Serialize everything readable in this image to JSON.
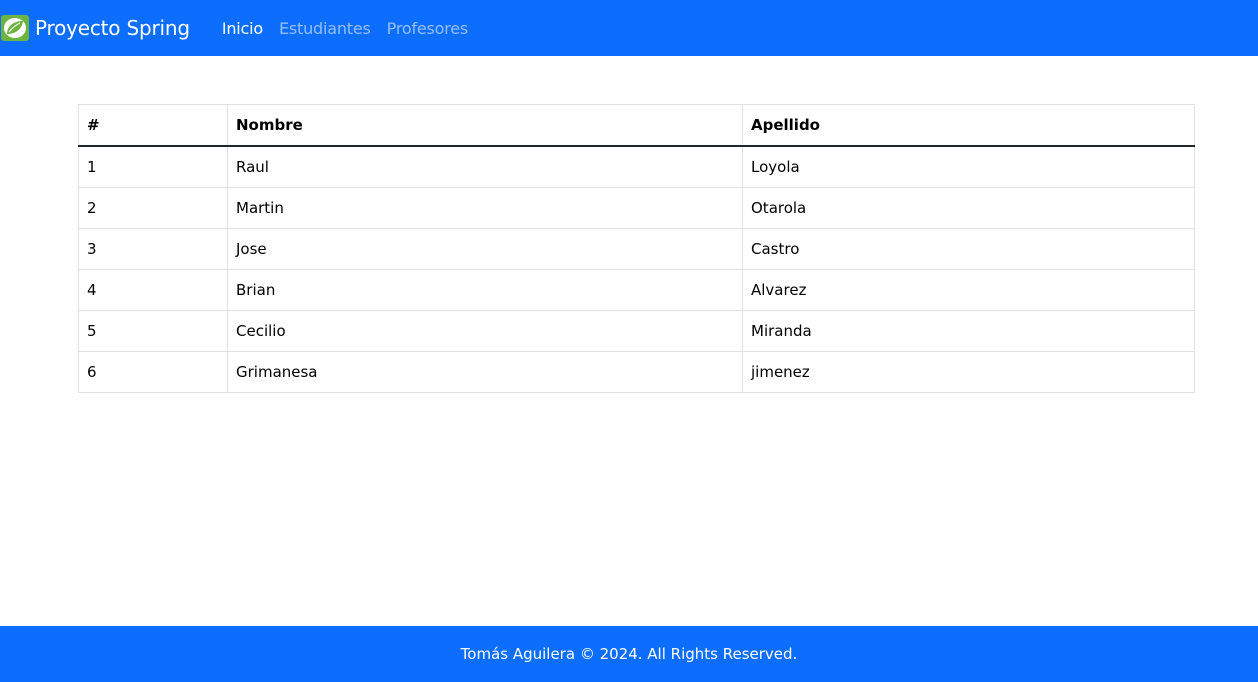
{
  "navbar": {
    "brand": "Proyecto Spring",
    "logo_icon": "spring-leaf-icon",
    "links": [
      {
        "label": "Inicio",
        "active": true
      },
      {
        "label": "Estudiantes",
        "active": false
      },
      {
        "label": "Profesores",
        "active": false
      }
    ]
  },
  "table": {
    "headers": [
      "#",
      "Nombre",
      "Apellido"
    ],
    "rows": [
      [
        "1",
        "Raul",
        "Loyola"
      ],
      [
        "2",
        "Martin",
        "Otarola"
      ],
      [
        "3",
        "Jose",
        "Castro"
      ],
      [
        "4",
        "Brian",
        "Alvarez"
      ],
      [
        "5",
        "Cecilio",
        "Miranda"
      ],
      [
        "6",
        "Grimanesa",
        "jimenez"
      ]
    ]
  },
  "footer": {
    "text": "Tomás Aguilera © 2024. All Rights Reserved."
  },
  "colors": {
    "primary": "#0d6efd",
    "logo_green": "#6db33f"
  }
}
